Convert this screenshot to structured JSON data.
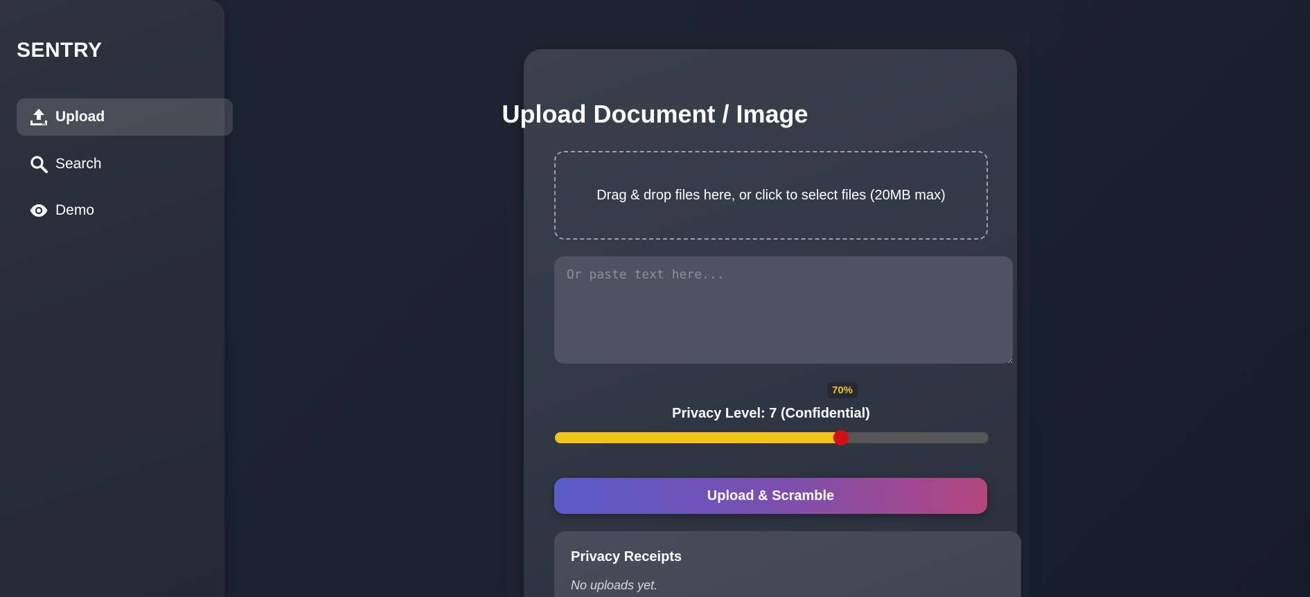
{
  "app": {
    "brand": "SENTRY"
  },
  "sidebar": {
    "items": [
      {
        "label": "Upload",
        "icon": "upload-icon",
        "active": true
      },
      {
        "label": "Search",
        "icon": "search-icon",
        "active": false
      },
      {
        "label": "Demo",
        "icon": "eye-icon",
        "active": false
      }
    ]
  },
  "upload": {
    "title": "Upload Document / Image",
    "dropzone_text": "Drag & drop files here, or click to select files (20MB max)",
    "paste_placeholder": "Or paste text here...",
    "paste_value": "",
    "privacy": {
      "badge": "70%",
      "label": "Privacy Level: 7 (Confidential)",
      "level": 7,
      "max": 10,
      "fraction": 0.66
    },
    "submit_label": "Upload & Scramble"
  },
  "receipts": {
    "title": "Privacy Receipts",
    "empty_text": "No uploads yet."
  },
  "colors": {
    "slider_fill": "#f2c318",
    "slider_thumb": "#d40f12",
    "badge_text": "#f2c318",
    "button_gradient_start": "#5a5bc9",
    "button_gradient_end": "#b4467f"
  }
}
